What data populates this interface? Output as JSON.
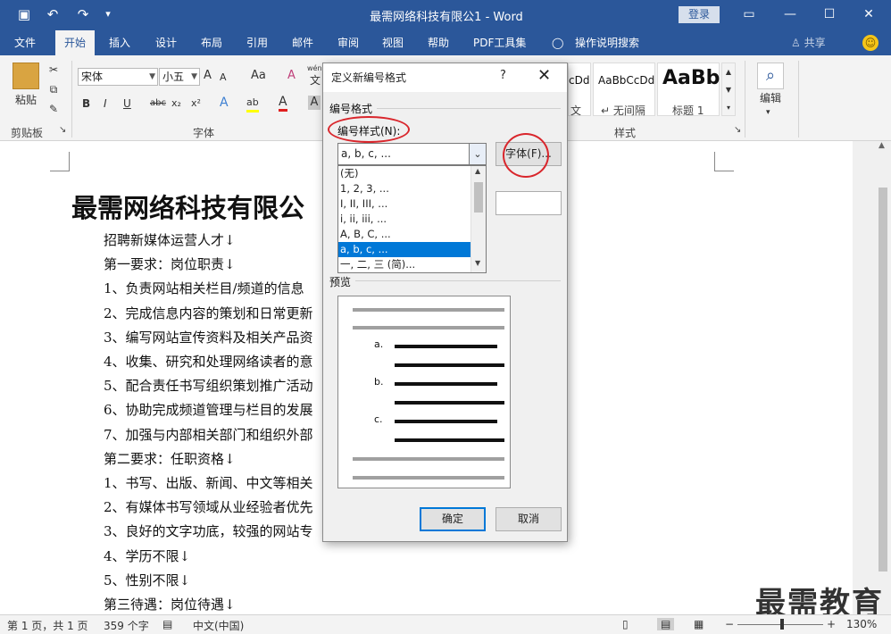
{
  "titlebar": {
    "title": "最需网络科技有限公1 - Word",
    "login": "登录",
    "save_icon": "▣",
    "undo_icon": "↶",
    "redo_icon": "↷",
    "customize_icon": "▾",
    "ribbon_options_icon": "▭",
    "minimize": "—",
    "maximize": "☐",
    "close": "✕"
  },
  "tabs": {
    "file": "文件",
    "home": "开始",
    "insert": "插入",
    "design": "设计",
    "layout": "布局",
    "references": "引用",
    "mailings": "邮件",
    "review": "审阅",
    "view": "视图",
    "help": "帮助",
    "pdf": "PDF工具集",
    "tellme_icon": "◯",
    "tellme": "操作说明搜索",
    "share": "♙ 共享",
    "smile": "☺"
  },
  "ribbon": {
    "paste_label": "粘贴",
    "clipboard_label": "剪贴板",
    "font_group_label": "字体",
    "styles_group_label": "样式",
    "edit_label": "编辑",
    "font_name": "宋体",
    "font_size": "小五",
    "grow": "A",
    "shrink": "A",
    "case": "Aa",
    "clear": "A",
    "wen": "wén",
    "wen_sub": "文",
    "bold": "B",
    "italic": "I",
    "underline": "U",
    "strike": "abc",
    "sub": "x₂",
    "sup": "x²",
    "effects": "A",
    "highlight": "ab",
    "fontcolor": "A",
    "shade": "A",
    "style1_sample": "cDd",
    "style1_name": "文",
    "style2_sample": "AaBbCcDd",
    "style2_name": "↵ 无间隔",
    "style3_sample": "AaBb",
    "style3_name": "标题 1",
    "search_icon": "⌕",
    "launcher": "↘"
  },
  "document": {
    "title": "最需网络科技有限公",
    "lines": [
      "招聘新媒体运营人才↓",
      "第一要求：岗位职责↓",
      "1、负责网站相关栏目/频道的信息",
      "2、完成信息内容的策划和日常更新",
      "3、编写网站宣传资料及相关产品资",
      "4、收集、研究和处理网络读者的意",
      "5、配合责任书写组织策划推广活动",
      "6、协助完成频道管理与栏目的发展",
      "7、加强与内部相关部门和组织外部",
      "第二要求：任职资格↓",
      "1、书写、出版、新闻、中文等相关",
      "2、有媒体书写领域从业经验者优先",
      "3、良好的文字功底，较强的网站专",
      "4、学历不限↓",
      "5、性别不限↓",
      "第三待遇：岗位待遇↓"
    ],
    "watermark": "最需教育"
  },
  "statusbar": {
    "page": "第 1 页，共 1 页",
    "words": "359 个字",
    "proof_icon": "▤",
    "lang": "中文(中国)",
    "view_read": "▯",
    "view_print": "▤",
    "view_web": "▦",
    "zoom_minus": "−",
    "zoom_plus": "+",
    "zoom": "130%"
  },
  "dialog": {
    "title": "定义新编号格式",
    "help": "?",
    "close": "✕",
    "section_format": "编号格式",
    "style_label": "编号样式(N):",
    "style_value": "a, b, c, ...",
    "font_button": "字体(F)...",
    "options": [
      "(无)",
      "1, 2, 3, ...",
      "I, II, III, ...",
      "i, ii, iii, ...",
      "A, B, C, ...",
      "a, b, c, ...",
      "一, 二, 三 (简)..."
    ],
    "selected_option": "a, b, c, ...",
    "preview_label": "预览",
    "preview_markers": [
      "a.",
      "b.",
      "c."
    ],
    "ok": "确定",
    "cancel": "取消"
  }
}
